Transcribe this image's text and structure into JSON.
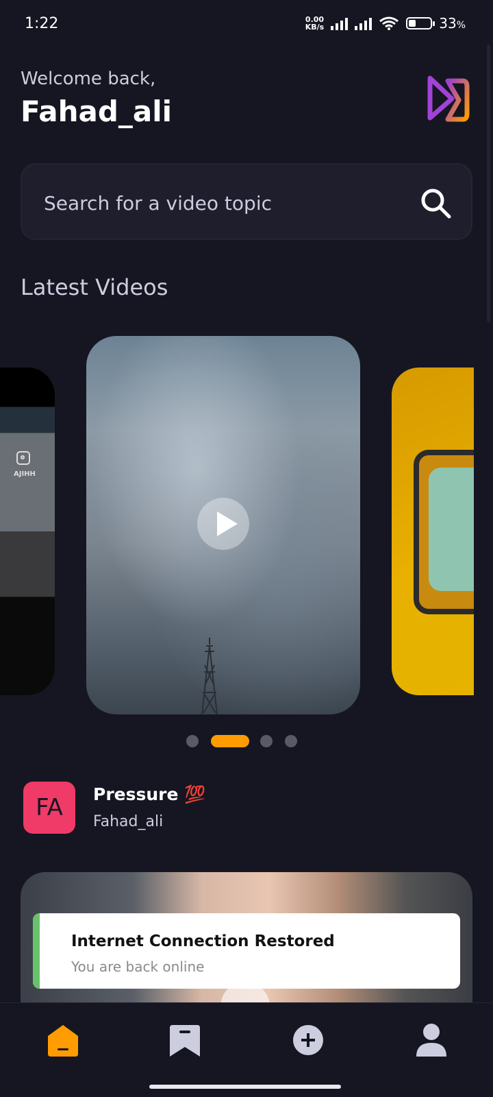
{
  "status_bar": {
    "time": "1:22",
    "net_speed_value": "0.00",
    "net_speed_unit": "KB/s",
    "battery": "33",
    "battery_unit": "%"
  },
  "header": {
    "welcome": "Welcome back,",
    "username": "Fahad_ali",
    "logo_icon": "play-logo-icon"
  },
  "search": {
    "placeholder": "Search for a video topic",
    "value": ""
  },
  "latest": {
    "title": "Latest Videos",
    "left_card_handle": "AJIHH",
    "pagination": {
      "count": 4,
      "active_index": 1
    }
  },
  "video": {
    "avatar_initials": "FA",
    "title": "Pressure 💯",
    "creator": "Fahad_ali"
  },
  "toast": {
    "title": "Internet Connection Restored",
    "message": "You are back online"
  },
  "tabs": [
    {
      "icon": "home-icon",
      "active": true
    },
    {
      "icon": "bookmark-icon",
      "active": false
    },
    {
      "icon": "create-icon",
      "active": false
    },
    {
      "icon": "profile-icon",
      "active": false
    }
  ],
  "colors": {
    "background": "#161622",
    "accent": "#ff9c01",
    "avatar": "#f03a67",
    "toast_bar": "#69c26b"
  }
}
